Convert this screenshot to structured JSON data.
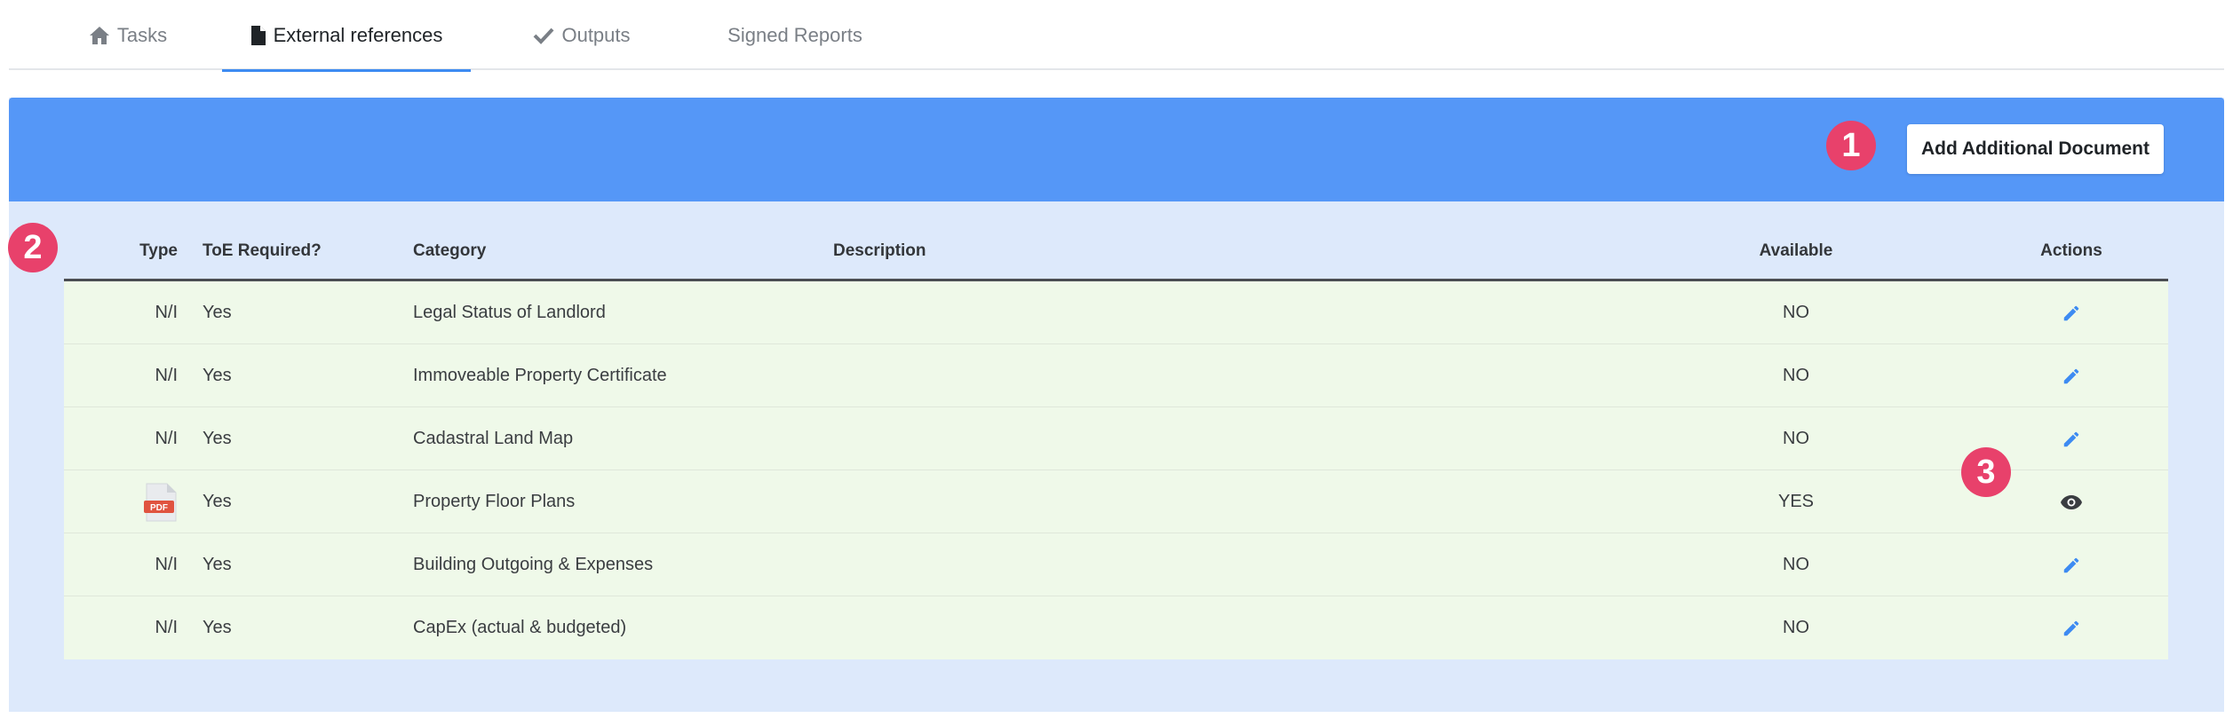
{
  "tabs": [
    {
      "label": "Tasks",
      "icon": "home-icon"
    },
    {
      "label": "External references",
      "icon": "document-icon"
    },
    {
      "label": "Outputs",
      "icon": "checkmark-icon"
    },
    {
      "label": "Signed Reports"
    }
  ],
  "toolbar": {
    "add_label": "Add Additional Document"
  },
  "markers": [
    "1",
    "2",
    "3"
  ],
  "table": {
    "headers": {
      "type": "Type",
      "toe": "ToE Required?",
      "category": "Category",
      "description": "Description",
      "available": "Available",
      "actions": "Actions"
    },
    "rows": [
      {
        "type": "N/I",
        "toe": "Yes",
        "category": "Legal Status of Landlord",
        "description": "",
        "available": "NO",
        "action": "edit-icon"
      },
      {
        "type": "N/I",
        "toe": "Yes",
        "category": "Immoveable Property Certificate",
        "description": "",
        "available": "NO",
        "action": "edit-icon"
      },
      {
        "type": "N/I",
        "toe": "Yes",
        "category": "Cadastral Land Map",
        "description": "",
        "available": "NO",
        "action": "edit-icon"
      },
      {
        "type": "PDF",
        "toe": "Yes",
        "category": "Property Floor Plans",
        "description": "",
        "available": "YES",
        "action": "eye-icon"
      },
      {
        "type": "N/I",
        "toe": "Yes",
        "category": "Building Outgoing & Expenses",
        "description": "",
        "available": "NO",
        "action": "edit-icon"
      },
      {
        "type": "N/I",
        "toe": "Yes",
        "category": "CapEx (actual & budgeted)",
        "description": "",
        "available": "NO",
        "action": "edit-icon"
      }
    ]
  },
  "colors": {
    "accent": "#5597f7",
    "panel": "#dde9fb",
    "row": "#eff9e9",
    "marker": "#e8416b",
    "pdf": "#e0533f"
  }
}
